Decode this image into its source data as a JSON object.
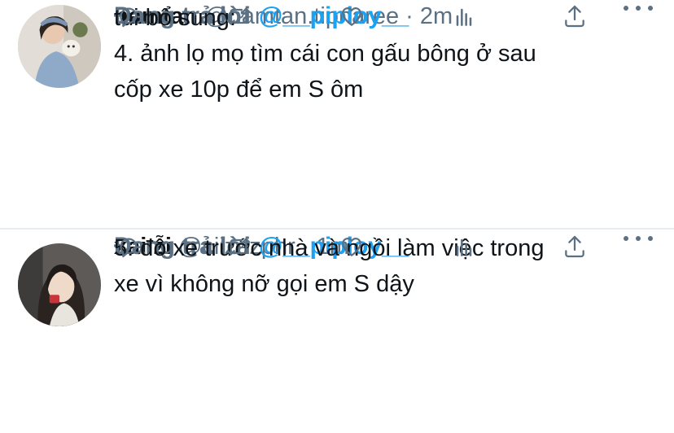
{
  "tweets": [
    {
      "name": "namtan",
      "handle": "@namtan.tipnaree",
      "separator": "·",
      "time": "2m",
      "reply_prefix": "Đang trả lời",
      "reply_to": "@__piploy__",
      "lines": [
        "tui bổ sung:",
        "4. ảnh lọ mọ tìm cái con gấu bông ở sau",
        "cốp xe 10p để em S ôm"
      ]
    },
    {
      "name": "xai zi",
      "handle": "@ciizezphr",
      "separator": "·",
      "time": "1m",
      "reply_prefix": "Đang trả lời",
      "reply_to": "@__piploy__",
      "lines": [
        "5. đỗ xe trước nhà và ngồi làm việc trong",
        "xe vì không nỡ gọi em S dậy"
      ]
    }
  ],
  "icons": [
    "reply-icon",
    "retweet-icon",
    "like-icon",
    "analytics-icon",
    "share-icon",
    "more-icon"
  ],
  "colors": {
    "text": "#0f1419",
    "secondary": "#5b7083",
    "link": "#1da1f2",
    "divider": "#e6ecf0"
  }
}
